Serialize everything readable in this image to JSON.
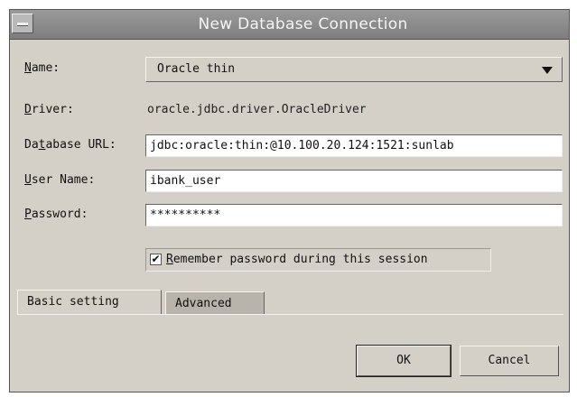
{
  "dialog": {
    "title": "New Database Connection"
  },
  "fields": {
    "name": {
      "label_m": "N",
      "label_rest": "ame:",
      "value": "Oracle thin"
    },
    "driver": {
      "label_m": "D",
      "label_rest": "river:",
      "value": "oracle.jdbc.driver.OracleDriver"
    },
    "url": {
      "label_pre": "Da",
      "label_m": "t",
      "label_rest": "abase URL:",
      "value": "jdbc:oracle:thin:@10.100.20.124:1521:sunlab"
    },
    "user": {
      "label_m": "U",
      "label_rest": "ser Name:",
      "value": "ibank_user"
    },
    "password": {
      "label_m": "P",
      "label_rest": "assword:",
      "value": "**********"
    }
  },
  "remember": {
    "checked": true,
    "check_glyph": "✔",
    "label_m": "R",
    "label_rest": "emember password during this session"
  },
  "tabs": {
    "basic": "Basic setting",
    "advanced": "Advanced"
  },
  "buttons": {
    "ok": "OK",
    "cancel": "Cancel"
  }
}
